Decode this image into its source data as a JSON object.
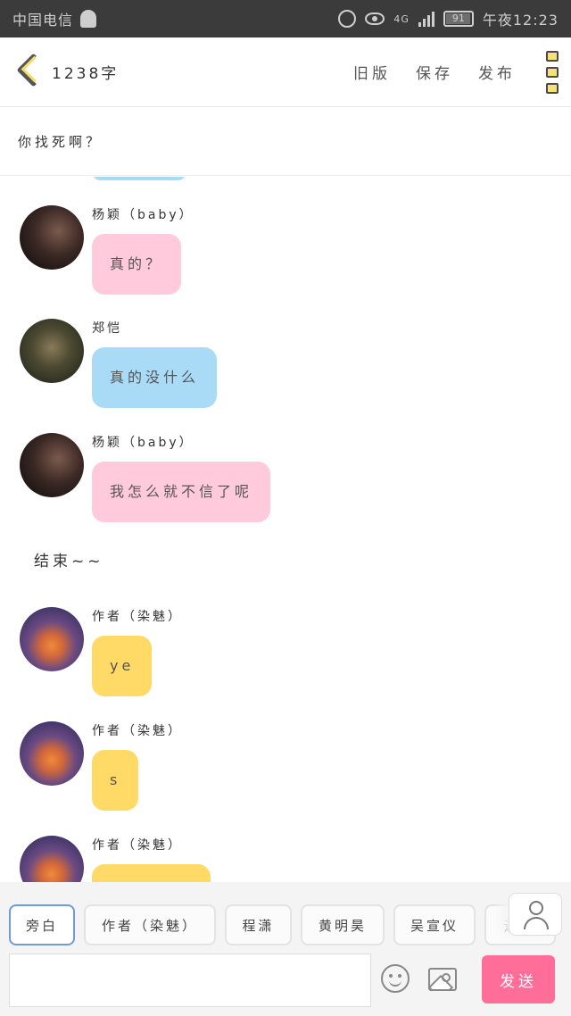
{
  "status_bar": {
    "carrier": "中国电信",
    "network": "4G",
    "battery": "91",
    "time": "午夜12:23"
  },
  "header": {
    "title": "1238字",
    "actions": [
      "旧版",
      "保存",
      "发布"
    ]
  },
  "topic": "你找死啊？",
  "messages": [
    {
      "name": "杨颖（baby）",
      "text": "真的？",
      "color": "#ffcadb"
    },
    {
      "name": "郑恺",
      "text": "真的没什么",
      "color": "#a9dbf7"
    },
    {
      "name": "杨颖（baby）",
      "text": "我怎么就不信了呢",
      "color": "#ffcadb"
    },
    {
      "name": "作者（染魅）",
      "text": "ye",
      "color": "#ffda66"
    },
    {
      "name": "作者（染魅）",
      "text": "s",
      "color": "#ffda66"
    },
    {
      "name": "作者（染魅）",
      "text": "",
      "color": "#ffda66"
    }
  ],
  "narration": "结束~~",
  "roles": [
    "旁白",
    "作者（染魅）",
    "程潇",
    "黄明昊",
    "吴宣仪",
    "迪"
  ],
  "input": {
    "placeholder": ""
  },
  "send_label": "发送",
  "icons": [
    "back-icon",
    "menu-icon",
    "emoji-icon",
    "image-icon",
    "user-icon"
  ]
}
